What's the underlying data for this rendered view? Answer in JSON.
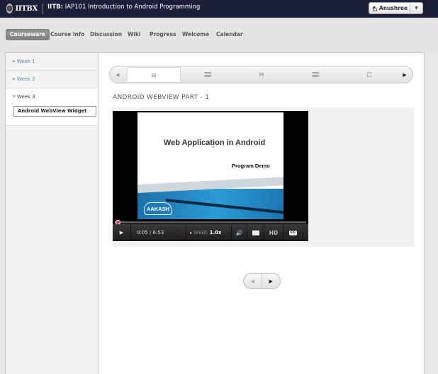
{
  "header": {
    "logo_text": "IITBX",
    "course_code": "IITB:",
    "course_title": "IAP101 Introduction to Android Programming",
    "user_name": "Anushree"
  },
  "nav": {
    "tabs": [
      {
        "label": "Courseware",
        "active": true
      },
      {
        "label": "Course Info",
        "active": false
      },
      {
        "label": "Discussion",
        "active": false
      },
      {
        "label": "Wiki",
        "active": false
      },
      {
        "label": "Progress",
        "active": false
      },
      {
        "label": "Welcome",
        "active": false
      },
      {
        "label": "Calendar",
        "active": false
      }
    ]
  },
  "sidebar": {
    "weeks": [
      {
        "label": "Week 1",
        "expanded": false
      },
      {
        "label": "Week 2",
        "expanded": false
      },
      {
        "label": "Week 3",
        "expanded": true
      }
    ],
    "active_item": "Android WebView Widget"
  },
  "sequence": {
    "tabs": [
      "video",
      "list",
      "video",
      "list",
      "doc"
    ],
    "active_index": 0
  },
  "unit": {
    "title": "ANDROID WEBVIEW PART - 1"
  },
  "video": {
    "slide_title": "Web Application in Android",
    "slide_subtitle": "Program Demo",
    "slide_logo": "AAKASH",
    "time": "0:05 / 6:53",
    "speed_label": "SPEED",
    "speed_value": "1.0x",
    "hd_label": "HD",
    "cc_label": "CC",
    "progress": 0.013
  },
  "colors": {
    "header_bg": "#1b1f3a",
    "link": "#4a8ec2",
    "progress": "#c0407a"
  }
}
